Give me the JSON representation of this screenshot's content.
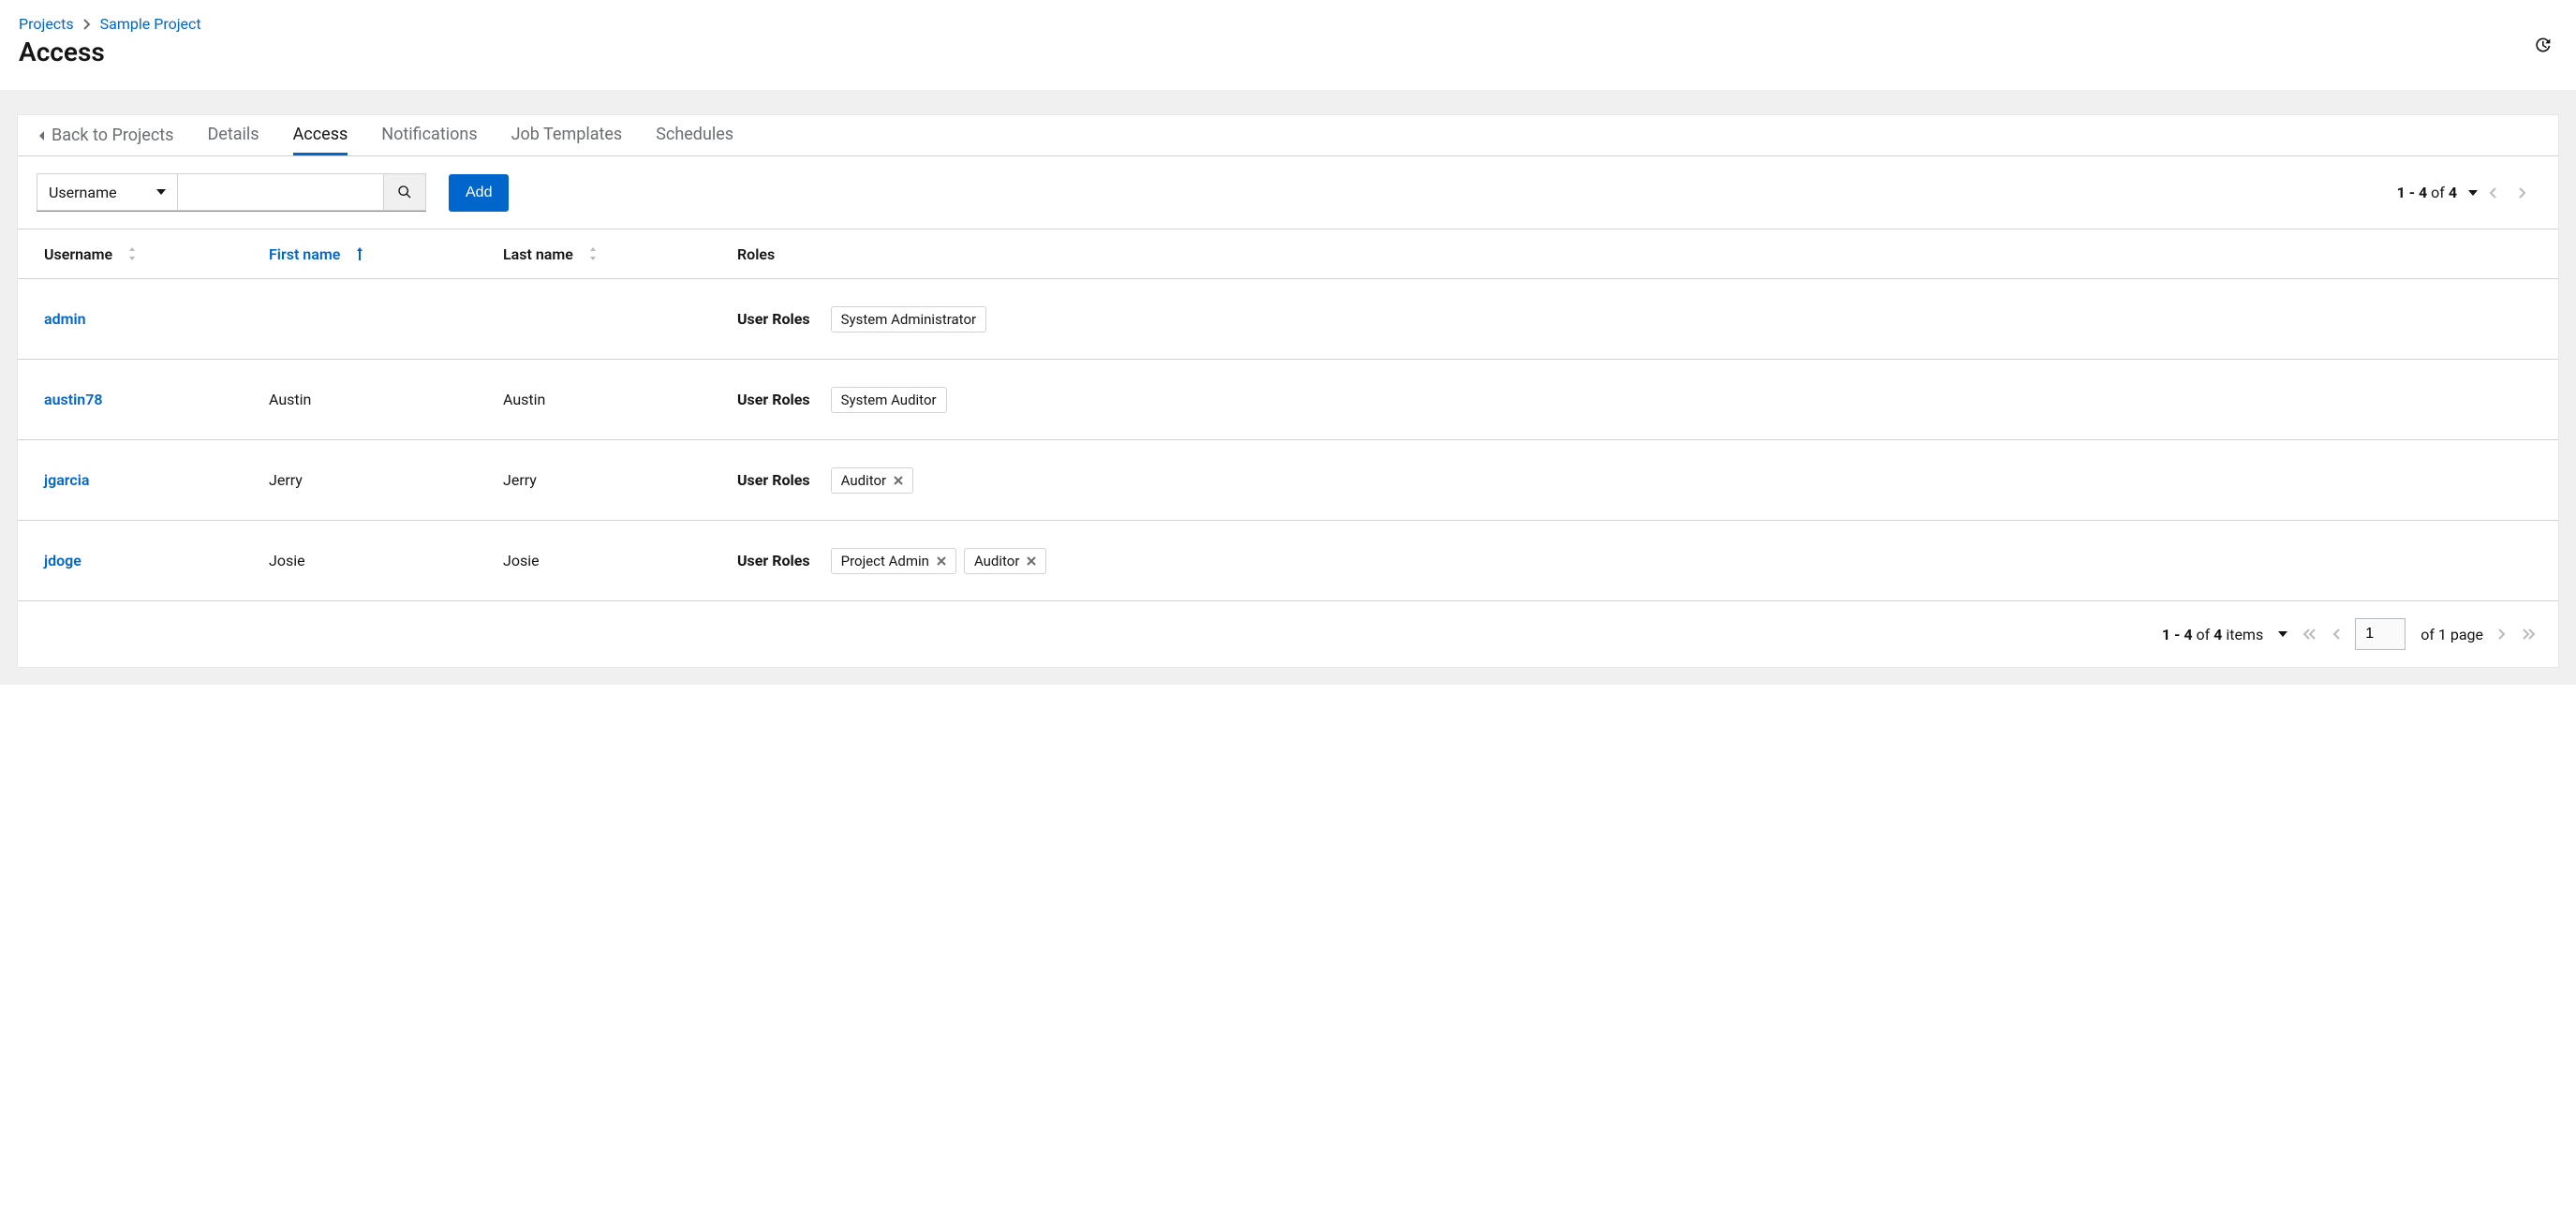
{
  "breadcrumb": {
    "root": "Projects",
    "current": "Sample Project"
  },
  "page_title": "Access",
  "tabs": {
    "back": "Back to Projects",
    "items": [
      "Details",
      "Access",
      "Notifications",
      "Job Templates",
      "Schedules"
    ],
    "active": "Access"
  },
  "toolbar": {
    "filter_by_label": "Username",
    "search_value": "",
    "add_label": "Add"
  },
  "top_pager": {
    "range_text": "1 - 4",
    "of_text": "of",
    "total": "4"
  },
  "columns": {
    "username": "Username",
    "first_name": "First name",
    "last_name": "Last name",
    "roles": "Roles"
  },
  "sort": {
    "column": "first_name",
    "direction": "asc"
  },
  "user_roles_label": "User Roles",
  "rows": [
    {
      "username": "admin",
      "first_name": "",
      "last_name": "",
      "roles": [
        {
          "label": "System Administrator",
          "removable": false
        }
      ]
    },
    {
      "username": "austin78",
      "first_name": "Austin",
      "last_name": "Austin",
      "roles": [
        {
          "label": "System Auditor",
          "removable": false
        }
      ]
    },
    {
      "username": "jgarcia",
      "first_name": "Jerry",
      "last_name": "Jerry",
      "roles": [
        {
          "label": "Auditor",
          "removable": true
        }
      ]
    },
    {
      "username": "jdoge",
      "first_name": "Josie",
      "last_name": "Josie",
      "roles": [
        {
          "label": "Project Admin",
          "removable": true
        },
        {
          "label": "Auditor",
          "removable": true
        }
      ]
    }
  ],
  "footer_pager": {
    "range_text": "1 - 4",
    "of_text": "of",
    "total": "4",
    "items_word": "items",
    "page_value": "1",
    "page_total_text": "of 1 page"
  }
}
